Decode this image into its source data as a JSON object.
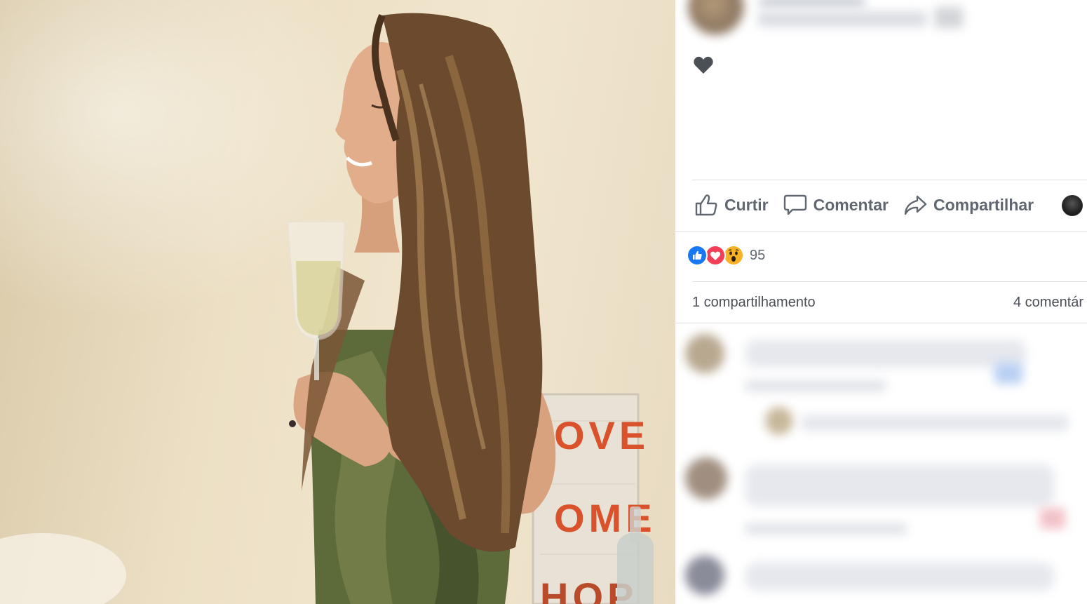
{
  "post": {
    "reactions_count": "95",
    "shares_label": "1 compartilhamento",
    "comments_label": "4 comentár"
  },
  "actions": {
    "like_label": "Curtir",
    "comment_label": "Comentar",
    "share_label": "Compartilhar"
  },
  "icons": {
    "heart": "heart-icon",
    "like": "thumbs-up-icon",
    "comment": "comment-bubble-icon",
    "share": "share-arrow-icon",
    "reaction_like": "like-reaction-icon",
    "reaction_love": "love-reaction-icon",
    "reaction_wow": "wow-reaction-icon"
  },
  "colors": {
    "like_blue": "#1877f2",
    "love_red": "#f33e58",
    "wow_yellow": "#f7b125",
    "action_gray": "#606770",
    "divider": "#dddfe2"
  },
  "photo": {
    "sign_text": [
      "OVE",
      "OME",
      "HOP"
    ]
  }
}
